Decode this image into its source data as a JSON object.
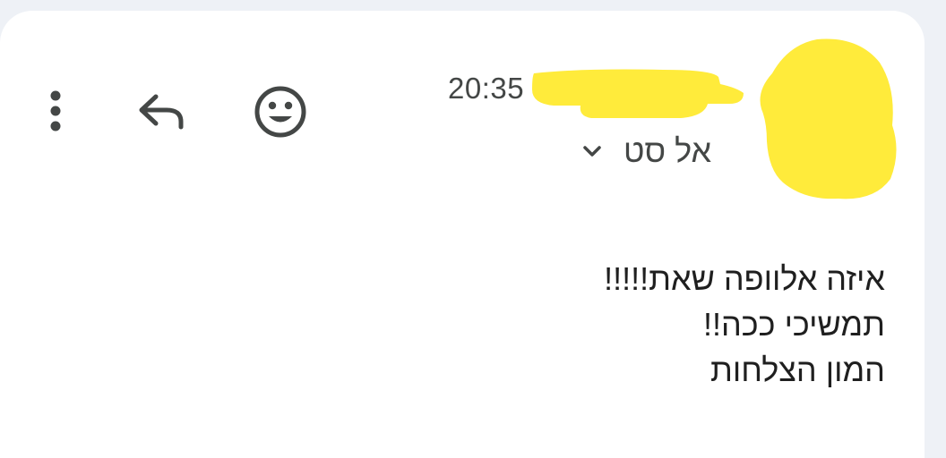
{
  "message": {
    "time": "20:35",
    "recipient_name": "אל סט",
    "body_lines": [
      "איזה אלוופה שאת!!!!!",
      "תמשיכי ככה!!",
      "המון הצלחות"
    ]
  },
  "icons": {
    "more": "more-vert-icon",
    "reply": "reply-icon",
    "emoji": "emoji-reaction-icon",
    "recipient_expand": "chevron-down-icon"
  },
  "colors": {
    "background": "#eef1f6",
    "card": "#ffffff",
    "icon": "#444746",
    "text": "#1f1f1f",
    "redaction": "#ffeb3b"
  }
}
